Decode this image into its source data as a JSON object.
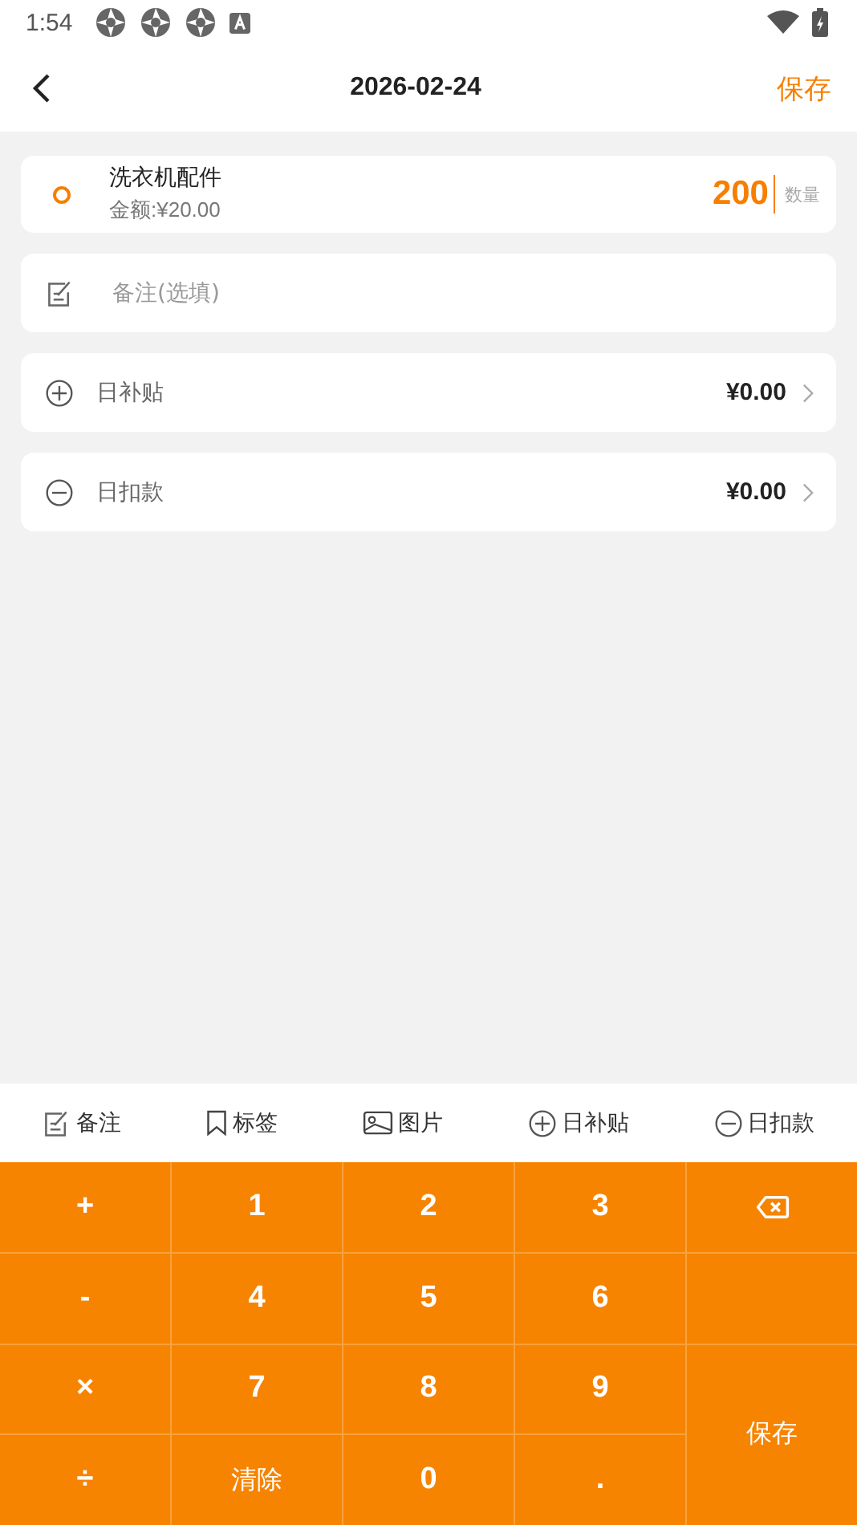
{
  "status_bar": {
    "time": "1:54"
  },
  "header": {
    "title": "2026-02-24",
    "action": "保存"
  },
  "item": {
    "name": "洗衣机配件",
    "amount": "金额:¥20.00",
    "quantity": "200",
    "quantity_label": "数量"
  },
  "note": {
    "placeholder": "备注(选填)"
  },
  "adjustments": [
    {
      "kind": "add",
      "label": "日补贴",
      "value": "¥0.00"
    },
    {
      "kind": "subtract",
      "label": "日扣款",
      "value": "¥0.00"
    }
  ],
  "toolbar": [
    {
      "kind": "note",
      "label": "备注"
    },
    {
      "kind": "tag",
      "label": "标签"
    },
    {
      "kind": "image",
      "label": "图片"
    },
    {
      "kind": "add",
      "label": "日补贴"
    },
    {
      "kind": "subtract",
      "label": "日扣款"
    }
  ],
  "keypad": [
    {
      "kind": "key",
      "label": "+"
    },
    {
      "kind": "key",
      "label": "1"
    },
    {
      "kind": "key",
      "label": "2"
    },
    {
      "kind": "key",
      "label": "3"
    },
    {
      "kind": "backspace"
    },
    {
      "kind": "key",
      "label": "-"
    },
    {
      "kind": "key",
      "label": "4"
    },
    {
      "kind": "key",
      "label": "5"
    },
    {
      "kind": "key",
      "label": "6"
    },
    {
      "kind": "empty"
    },
    {
      "kind": "key",
      "label": "×"
    },
    {
      "kind": "key",
      "label": "7"
    },
    {
      "kind": "key",
      "label": "8"
    },
    {
      "kind": "key",
      "label": "9"
    },
    {
      "kind": "save",
      "label": "保存"
    },
    {
      "kind": "key",
      "label": "÷"
    },
    {
      "kind": "word",
      "label": "清除"
    },
    {
      "kind": "key",
      "label": "0"
    },
    {
      "kind": "key",
      "label": "."
    }
  ]
}
